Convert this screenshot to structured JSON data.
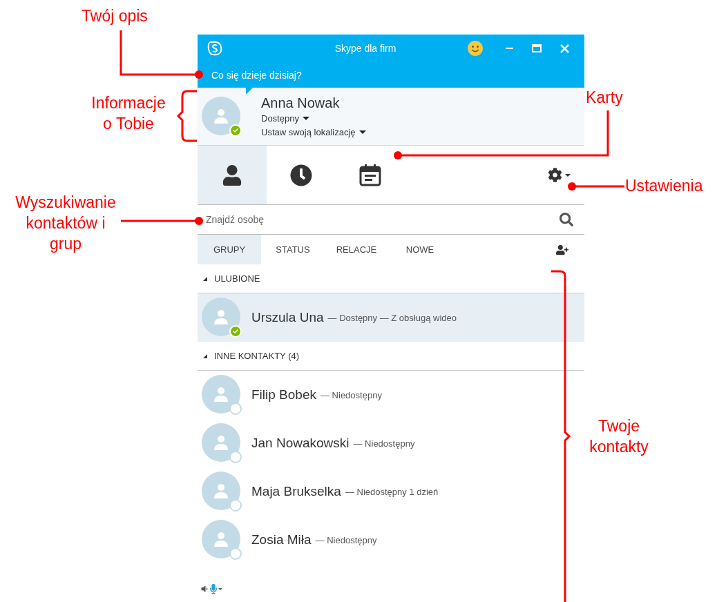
{
  "window": {
    "title": "Skype dla firm"
  },
  "note": {
    "placeholder": "Co się dzieje dzisiaj?"
  },
  "profile": {
    "name": "Anna Nowak",
    "presence": "Dostępny",
    "location": "Ustaw swoją lokalizację",
    "online": true
  },
  "main_tabs": [
    {
      "kind": "contacts",
      "selected": true
    },
    {
      "kind": "history",
      "selected": false
    },
    {
      "kind": "meetings",
      "selected": false
    }
  ],
  "search": {
    "placeholder": "Znajdź osobę"
  },
  "filter_tabs": [
    {
      "label": "GRUPY",
      "selected": true
    },
    {
      "label": "STATUS",
      "selected": false
    },
    {
      "label": "RELACJE",
      "selected": false
    },
    {
      "label": "NOWE",
      "selected": false
    }
  ],
  "groups": [
    {
      "title": "ULUBIONE",
      "expanded": true,
      "contacts": [
        {
          "name": "Urszula Una",
          "detail": "— Dostępny — Z obsługą wideo",
          "online": true,
          "selected": true
        }
      ]
    },
    {
      "title": "INNE KONTAKTY (4)",
      "expanded": true,
      "contacts": [
        {
          "name": "Filip Bobek",
          "detail": "— Niedostępny",
          "online": false,
          "selected": false
        },
        {
          "name": "Jan Nowakowski",
          "detail": "— Niedostępny",
          "online": false,
          "selected": false
        },
        {
          "name": "Maja Brukselka",
          "detail": "— Niedostępny 1 dzień",
          "online": false,
          "selected": false
        },
        {
          "name": "Zosia Miła",
          "detail": "— Niedostępny",
          "online": false,
          "selected": false
        }
      ]
    }
  ],
  "annotations": [
    {
      "lines": [
        "Twój opis"
      ]
    },
    {
      "lines": [
        "Informacje",
        "o Tobie"
      ]
    },
    {
      "lines": [
        "Karty"
      ]
    },
    {
      "lines": [
        "Ustawienia"
      ]
    },
    {
      "lines": [
        "Wyszukiwanie",
        "kontaktów i",
        "grup"
      ]
    },
    {
      "lines": [
        "Twoje",
        "kontakty"
      ]
    }
  ]
}
